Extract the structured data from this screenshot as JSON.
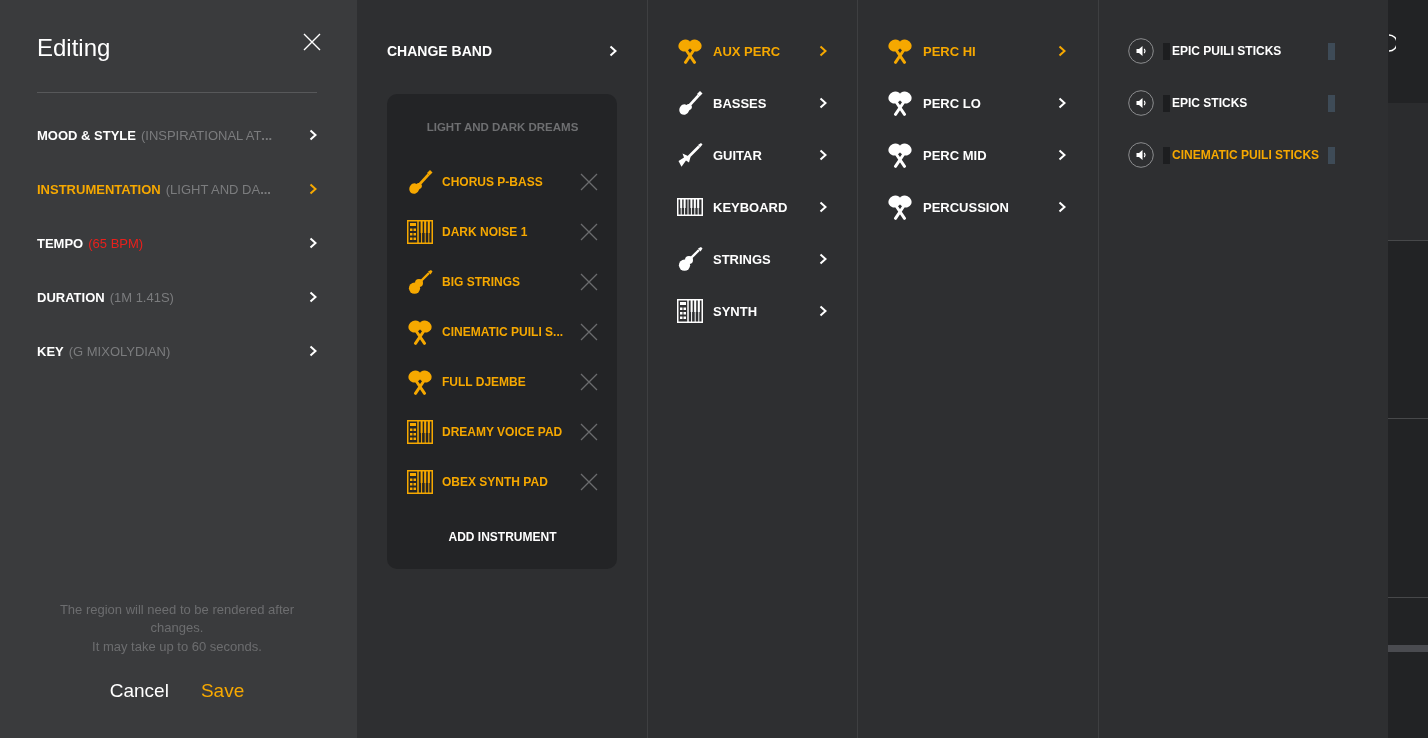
{
  "editor": {
    "title": "Editing",
    "menu": [
      {
        "label": "MOOD & STYLE",
        "value": "(INSPIRATIONAL AT**...**",
        "alert": false,
        "selected": false
      },
      {
        "label": "INSTRUMENTATION",
        "value": "(LIGHT AND DA**...**",
        "alert": false,
        "selected": true
      },
      {
        "label": "TEMPO",
        "value": "(65 BPM)",
        "alert": true,
        "selected": false
      },
      {
        "label": "DURATION",
        "value": "(1M 1.41S)",
        "alert": false,
        "selected": false
      },
      {
        "label": "KEY",
        "value": "(G MIXOLYDIAN)",
        "alert": false,
        "selected": false
      }
    ],
    "note": [
      "The region will need to be rendered after changes.",
      "It may take up to 60 seconds."
    ],
    "buttons": [
      {
        "label": "Cancel",
        "kind": "secondary"
      },
      {
        "label": "Save",
        "kind": "primary"
      }
    ]
  },
  "band": {
    "header": "CHANGE BAND",
    "name": "LIGHT AND DARK DREAMS",
    "instruments": [
      {
        "name": "CHORUS P-BASS",
        "kind": "bass"
      },
      {
        "name": "DARK NOISE 1",
        "kind": "synth"
      },
      {
        "name": "BIG STRINGS",
        "kind": "strings"
      },
      {
        "name": "CINEMATIC PUILI S...",
        "kind": "percussion"
      },
      {
        "name": "FULL DJEMBE",
        "kind": "percussion"
      },
      {
        "name": "DREAMY VOICE PAD",
        "kind": "synth"
      },
      {
        "name": "OBEX SYNTH PAD",
        "kind": "synth"
      }
    ],
    "add_button": "ADD INSTRUMENT"
  },
  "categories": [
    {
      "label": "AUX PERC",
      "kind": "percussion",
      "selected": true
    },
    {
      "label": "BASSES",
      "kind": "bass",
      "selected": false
    },
    {
      "label": "GUITAR",
      "kind": "guitar",
      "selected": false
    },
    {
      "label": "KEYBOARD",
      "kind": "keyboard",
      "selected": false
    },
    {
      "label": "STRINGS",
      "kind": "strings",
      "selected": false
    },
    {
      "label": "SYNTH",
      "kind": "synth",
      "selected": false
    }
  ],
  "subcategories": [
    {
      "label": "PERC HI",
      "kind": "percussion",
      "selected": true
    },
    {
      "label": "PERC LO",
      "kind": "percussion",
      "selected": false
    },
    {
      "label": "PERC MID",
      "kind": "percussion",
      "selected": false
    },
    {
      "label": "PERCUSSION",
      "kind": "percussion",
      "selected": false
    }
  ],
  "sounds": [
    {
      "label": "EPIC PUILI STICKS",
      "selected": false
    },
    {
      "label": "EPIC STICKS",
      "selected": false
    },
    {
      "label": "CINEMATIC PUILI STICKS",
      "selected": true
    }
  ]
}
